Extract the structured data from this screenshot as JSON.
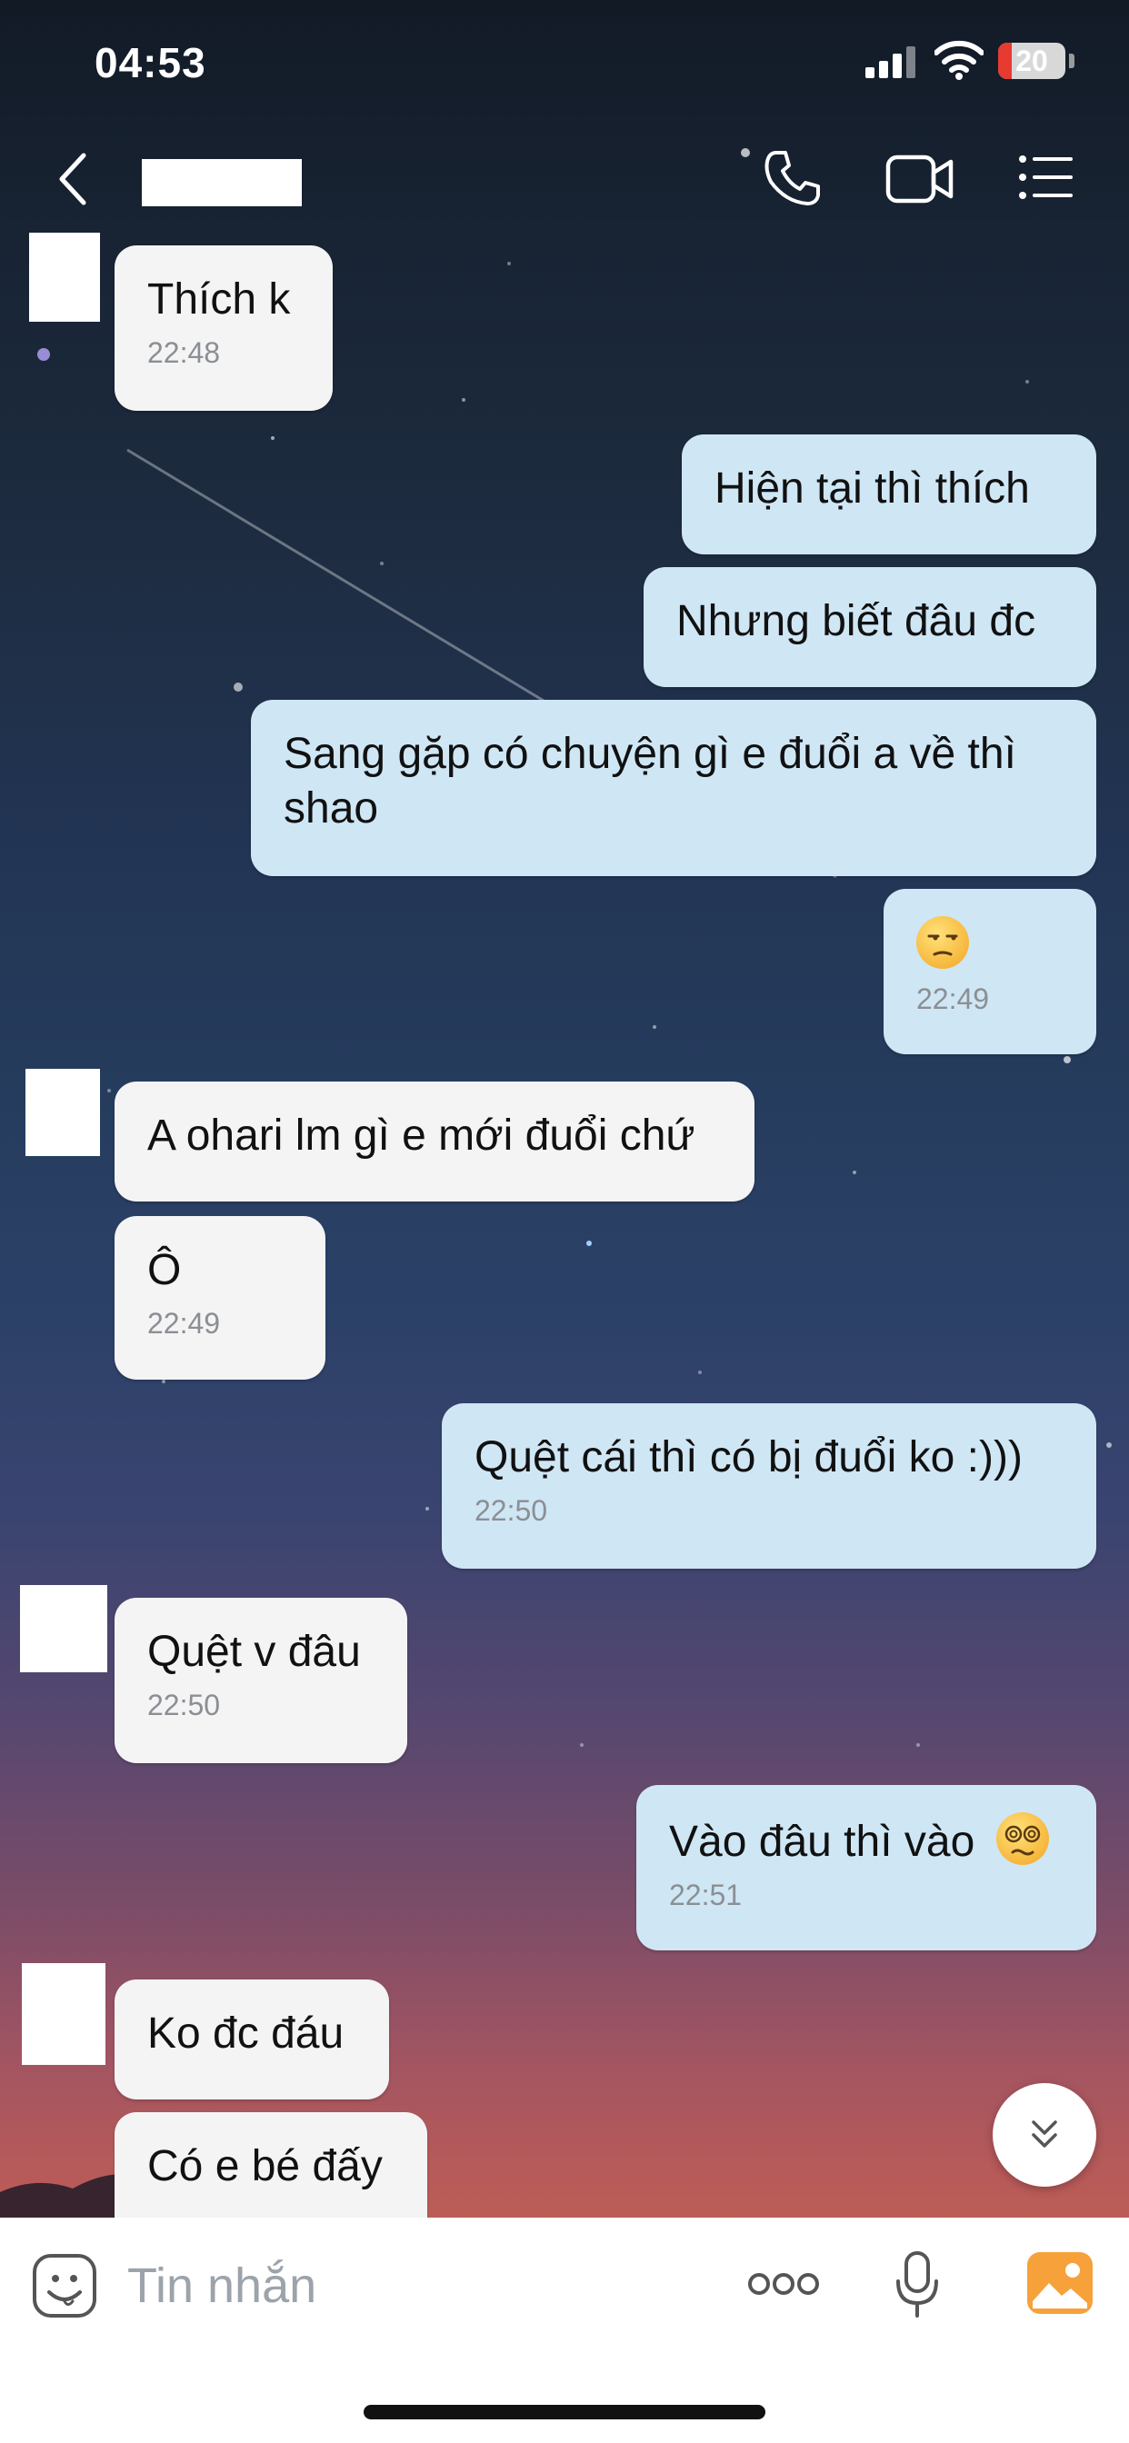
{
  "status_bar": {
    "time": "04:53",
    "battery_level": "20",
    "battery_fraction": 0.2,
    "battery_color": "#e63b30"
  },
  "header": {
    "back_icon": "chevron-left-icon",
    "call_icon": "phone-icon",
    "video_icon": "video-camera-icon",
    "menu_icon": "list-menu-icon"
  },
  "messages": [
    {
      "direction": "incoming",
      "text": "Thích k",
      "time": "22:48"
    },
    {
      "direction": "outgoing",
      "text": "Hiện tại thì thích",
      "time": ""
    },
    {
      "direction": "outgoing",
      "text": "Nhưng biết đâu đc",
      "time": ""
    },
    {
      "direction": "outgoing",
      "text": "Sang gặp có chuyện gì e đuổi a về thì shao",
      "time": ""
    },
    {
      "direction": "outgoing",
      "text": "",
      "emoji": "unamused-face",
      "time": "22:49"
    },
    {
      "direction": "incoming",
      "text": "A ohari lm gì e mới đuổi chứ",
      "time": ""
    },
    {
      "direction": "incoming",
      "text": "Ô",
      "time": "22:49"
    },
    {
      "direction": "outgoing",
      "text": "Quệt cái thì có bị đuổi ko :)))",
      "time": "22:50"
    },
    {
      "direction": "incoming",
      "text": "Quệt v đâu",
      "time": "22:50"
    },
    {
      "direction": "outgoing",
      "text": "Vào đâu thì vào",
      "emoji": "dizzy-face",
      "time": "22:51"
    },
    {
      "direction": "incoming",
      "text": "Ko đc đáu",
      "time": ""
    },
    {
      "direction": "incoming",
      "text": "Có e bé đấy",
      "time": ""
    }
  ],
  "composer": {
    "placeholder": "Tin nhắn",
    "value": "",
    "sticker_icon": "sticker-face-icon",
    "more_icon": "more-dots-icon",
    "mic_icon": "microphone-icon",
    "gallery_icon": "gallery-image-icon"
  },
  "colors": {
    "incoming_bubble": "#f4f4f5",
    "outgoing_bubble": "#cfe6f5",
    "gallery_accent": "#f7a13b"
  }
}
